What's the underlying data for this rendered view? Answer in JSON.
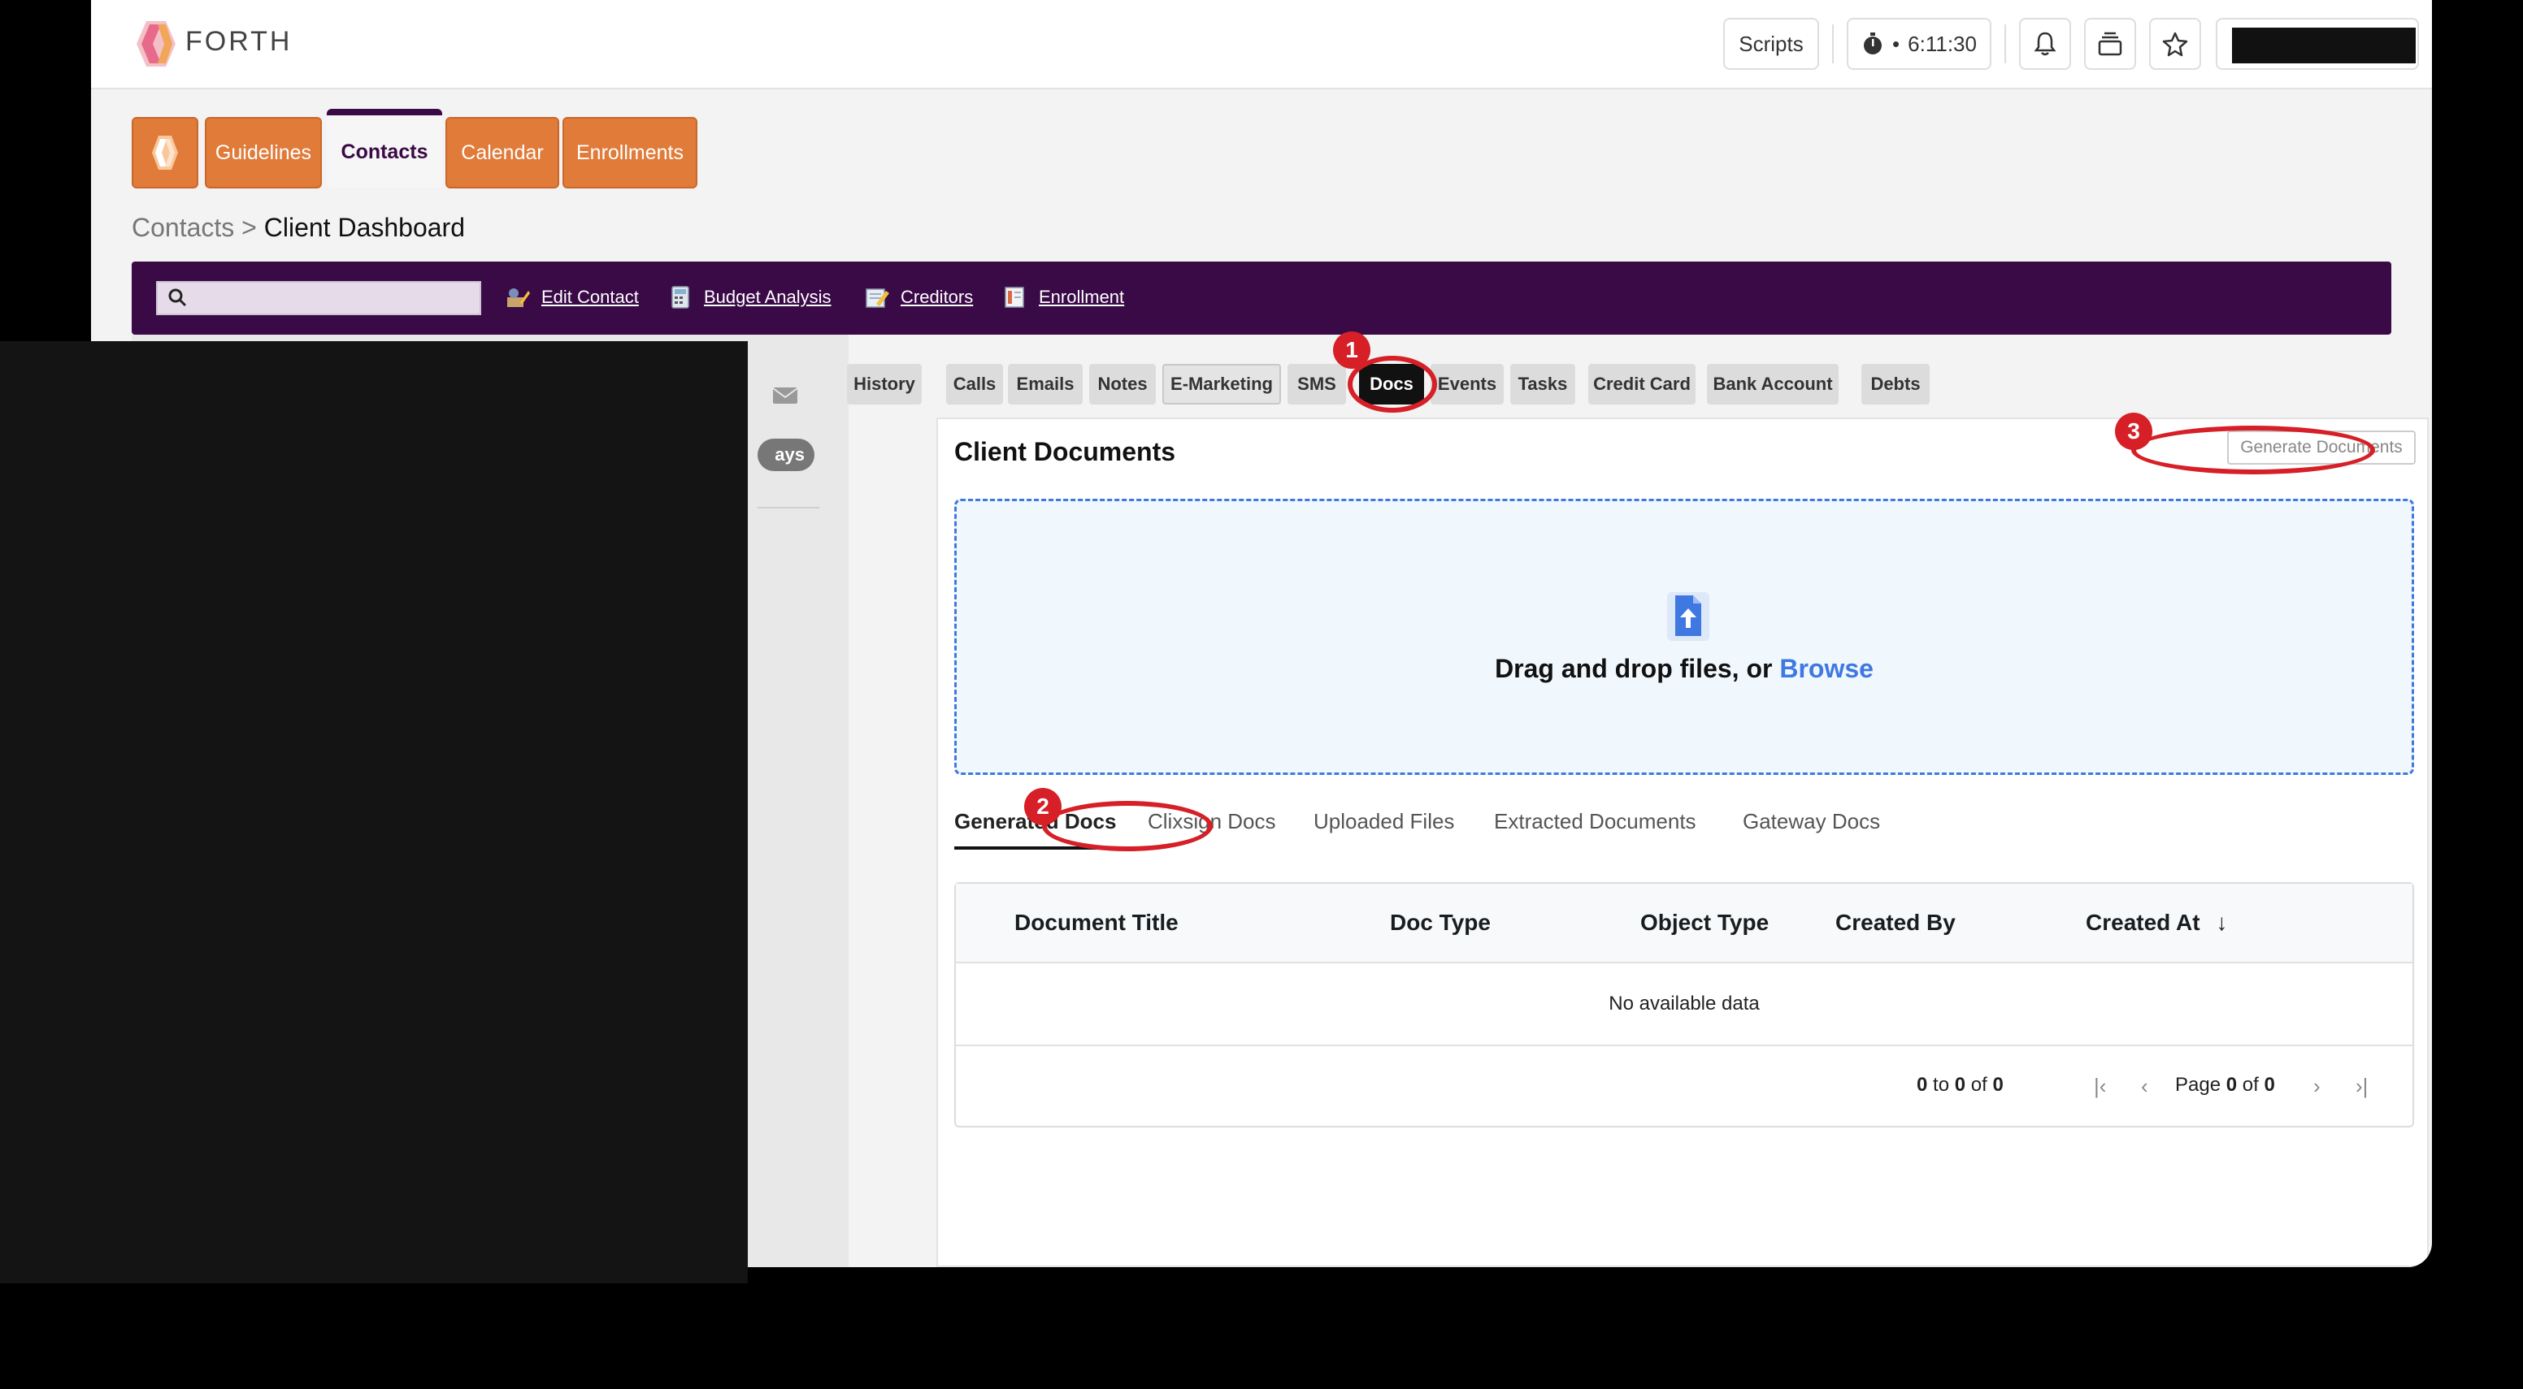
{
  "topbar": {
    "brand": "FORTH",
    "scripts_label": "Scripts",
    "timer": "6:11:30"
  },
  "nav": {
    "tabs": [
      {
        "label": "Guidelines"
      },
      {
        "label": "Contacts",
        "active": true
      },
      {
        "label": "Calendar"
      },
      {
        "label": "Enrollments"
      }
    ]
  },
  "breadcrumb": {
    "parent": "Contacts",
    "separator": " > ",
    "current": "Client Dashboard"
  },
  "toolbar": {
    "links": [
      {
        "label": "Edit Contact",
        "icon": "edit-contact-icon"
      },
      {
        "label": "Budget Analysis",
        "icon": "calculator-icon"
      },
      {
        "label": "Creditors",
        "icon": "creditors-icon"
      },
      {
        "label": "Enrollment",
        "icon": "enrollment-icon"
      }
    ]
  },
  "sidebar": {
    "pill": "ays"
  },
  "doc_tabs": [
    {
      "label": "History"
    },
    {
      "label": "Calls"
    },
    {
      "label": "Emails"
    },
    {
      "label": "Notes"
    },
    {
      "label": "E-Marketing"
    },
    {
      "label": "SMS"
    },
    {
      "label": "Docs",
      "active": true
    },
    {
      "label": "Events"
    },
    {
      "label": "Tasks"
    },
    {
      "label": "Credit Card"
    },
    {
      "label": "Bank Account"
    },
    {
      "label": "Debts"
    }
  ],
  "documents": {
    "title": "Client Documents",
    "generate_button": "Generate Documents",
    "dropzone_text": "Drag and drop files, or ",
    "dropzone_link": "Browse",
    "subtabs": [
      {
        "label": "Generated Docs",
        "active": true
      },
      {
        "label": "Clixsign Docs"
      },
      {
        "label": "Uploaded Files"
      },
      {
        "label": "Extracted Documents"
      },
      {
        "label": "Gateway Docs"
      }
    ],
    "columns": [
      "Document Title",
      "Doc Type",
      "Object Type",
      "Created By",
      "Created At"
    ],
    "sort_indicator": "↓",
    "empty_text": "No available data",
    "pagination": {
      "from": "0",
      "to_word": " to ",
      "to": "0",
      "of_word": " of ",
      "total": "0",
      "page_word": "Page ",
      "page": "0",
      "pages": "0"
    }
  },
  "annotations": [
    {
      "number": "1"
    },
    {
      "number": "2"
    },
    {
      "number": "3"
    }
  ],
  "colors": {
    "accent_orange": "#e07b39",
    "brand_purple": "#3a0a47",
    "annotation_red": "#d61f26",
    "link_blue": "#3f78e0"
  }
}
